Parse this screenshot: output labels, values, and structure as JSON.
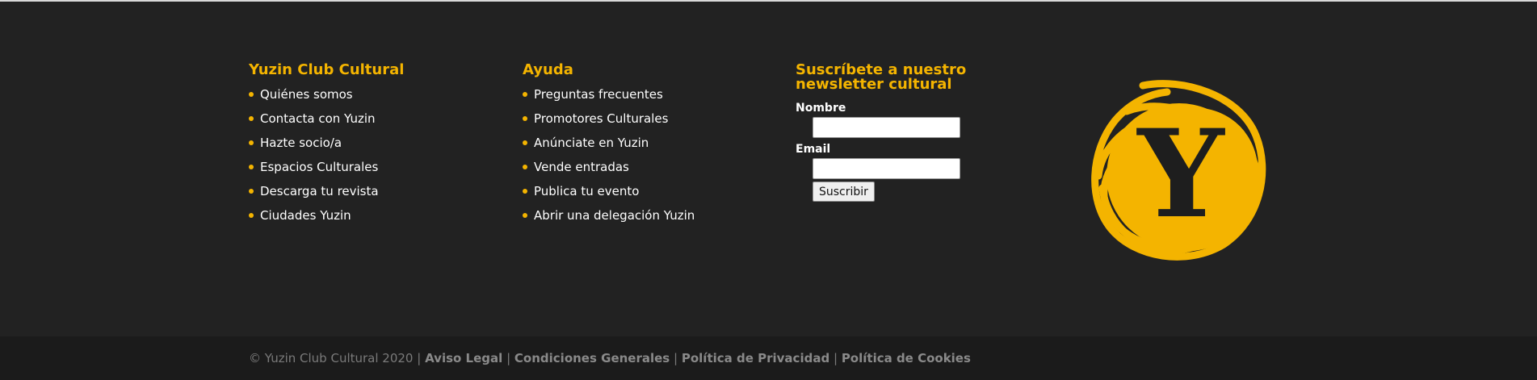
{
  "columns": {
    "club": {
      "title": "Yuzin Club Cultural",
      "links": [
        "Quiénes somos",
        "Contacta con Yuzin",
        "Hazte socio/a",
        "Espacios Culturales",
        "Descarga tu revista",
        "Ciudades Yuzin"
      ]
    },
    "help": {
      "title": "Ayuda",
      "links": [
        "Preguntas frecuentes",
        "Promotores Culturales",
        "Anúnciate en Yuzin",
        "Vende entradas",
        "Publica tu evento",
        "Abrir una delegación Yuzin"
      ]
    }
  },
  "newsletter": {
    "title": "Suscríbete a nuestro newsletter cultural",
    "name_label": "Nombre",
    "email_label": "Email",
    "name_value": "",
    "email_value": "",
    "submit_label": "Suscribir"
  },
  "logo": {
    "letter": "Y",
    "icon": "yuzin-logo-icon",
    "color": "#f4b400"
  },
  "bottom": {
    "copyright": "© Yuzin Club Cultural 2020",
    "separator": "|",
    "links": [
      "Aviso Legal",
      "Condiciones Generales",
      "Política de Privacidad",
      "Política de Cookies"
    ]
  },
  "colors": {
    "accent": "#f4b400",
    "background": "#222222",
    "bottom_background": "#1b1b1b"
  }
}
